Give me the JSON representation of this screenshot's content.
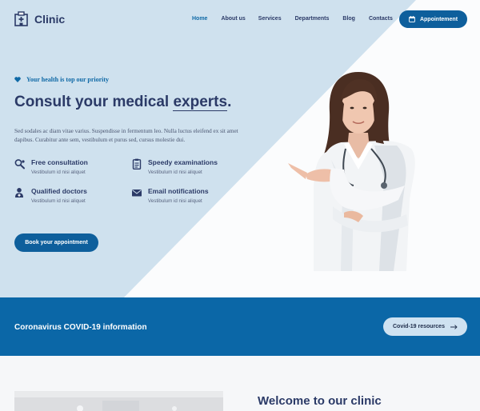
{
  "brand": {
    "name": "Clinic"
  },
  "nav": {
    "items": [
      "Home",
      "About us",
      "Services",
      "Departments",
      "Blog",
      "Contacts"
    ],
    "active": "Home",
    "appointment_label": "Appointement"
  },
  "hero": {
    "tagline": "Your health is top our priority",
    "heading_start": "Consult your medical ",
    "heading_highlight": "experts",
    "heading_end": ".",
    "description": "Sed sodales ac diam vitae varius. Suspendisse in fermentum leo. Nulla luctus eleifend ex sit amet dapibus. Curabitur ante sem, vestibulum et purus sed, cursus molestie dui.",
    "features": [
      {
        "title": "Free consultation",
        "subtitle": "Vestibulum id nisi aliquet",
        "icon": "stethoscope-icon"
      },
      {
        "title": "Speedy examinations",
        "subtitle": "Vestibulum id nisi aliquet",
        "icon": "clipboard-icon"
      },
      {
        "title": "Qualified doctors",
        "subtitle": "Vestibulum id nisi aliquet",
        "icon": "doctor-icon"
      },
      {
        "title": "Email notifications",
        "subtitle": "Vestibulum id nisi aliquet",
        "icon": "envelope-icon"
      }
    ],
    "book_label": "Book your appointment"
  },
  "banner": {
    "title": "Coronavirus COVID-19 information",
    "button_label": "Covid-19 resources"
  },
  "welcome": {
    "title": "Welcome to our clinic"
  },
  "colors": {
    "primary": "#0e5f9c",
    "banner": "#0b67a7",
    "hero_bg": "#cfe1ee",
    "heading": "#2b3a67",
    "accent": "#0f69a6"
  }
}
